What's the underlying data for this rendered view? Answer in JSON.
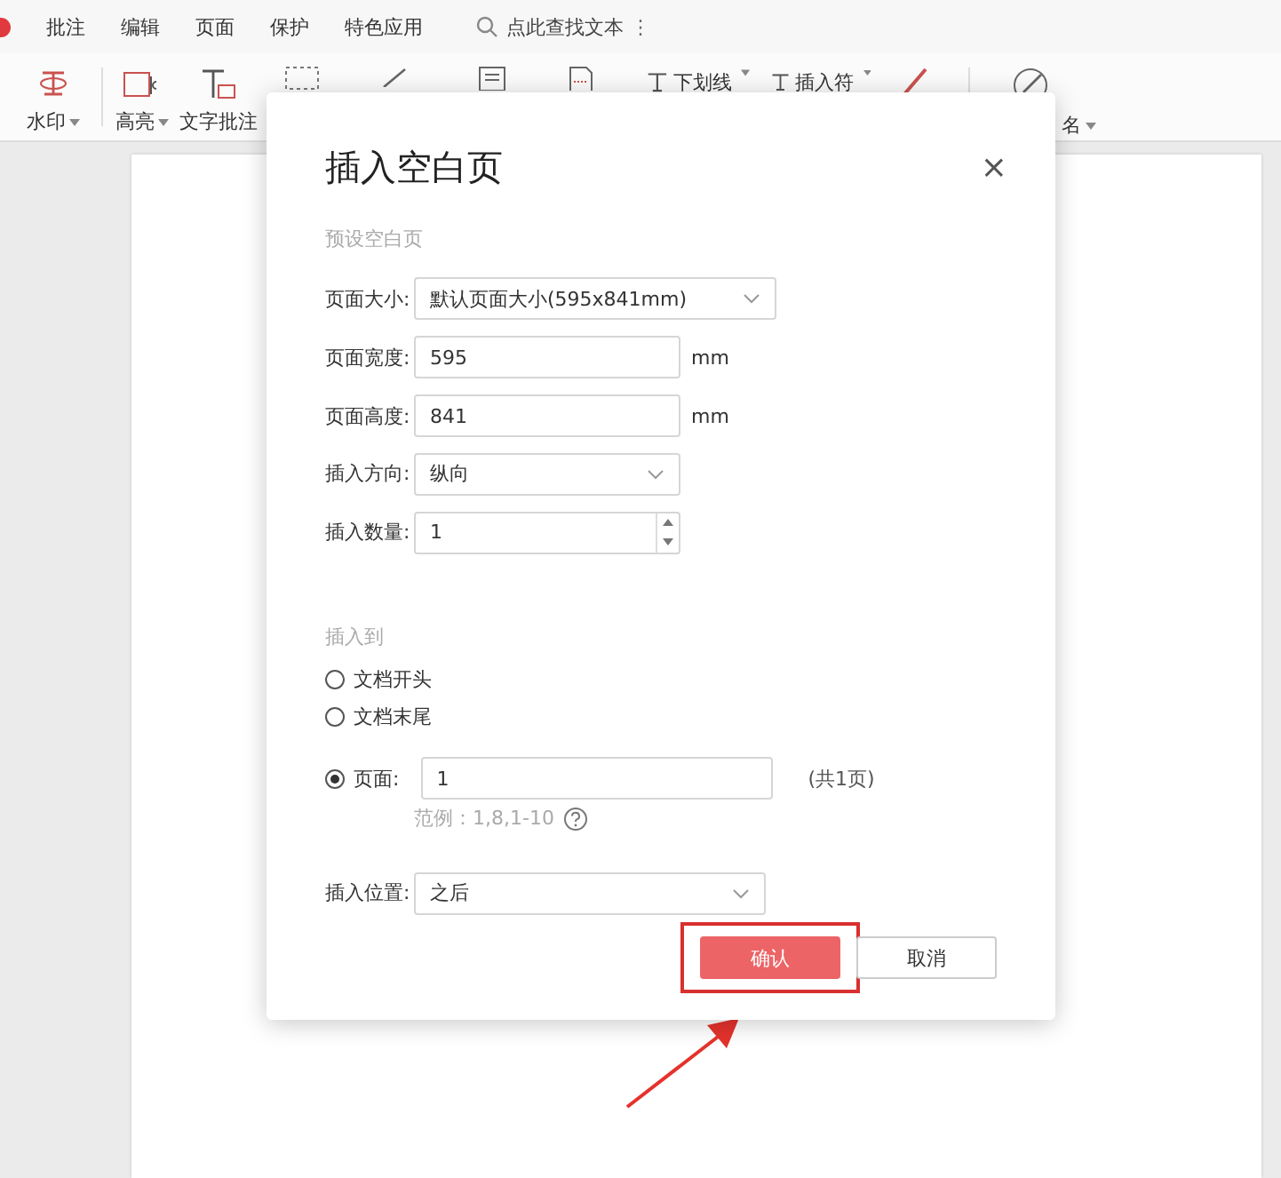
{
  "menu_bar": {
    "items": [
      {
        "label": "批注"
      },
      {
        "label": "编辑"
      },
      {
        "label": "页面"
      },
      {
        "label": "保护"
      },
      {
        "label": "特色应用"
      }
    ],
    "search": {
      "placeholder": "点此查找文本"
    },
    "more": "⋮"
  },
  "toolbar": {
    "items": [
      {
        "kind": "big",
        "label": "水印",
        "caret": true
      },
      {
        "kind": "separator"
      },
      {
        "kind": "big",
        "label": "高亮",
        "caret": true
      },
      {
        "kind": "big",
        "label": "文字批注",
        "caret": false
      },
      {
        "kind": "big"
      },
      {
        "kind": "big"
      },
      {
        "kind": "big"
      },
      {
        "kind": "big"
      },
      {
        "kind": "small",
        "label": "下划线",
        "caret": true
      },
      {
        "kind": "small",
        "label": "插入符",
        "caret": true
      },
      {
        "kind": "big"
      },
      {
        "kind": "separator"
      },
      {
        "kind": "big",
        "label": "名",
        "caret": true
      }
    ]
  },
  "dialog": {
    "title": "插入空白页",
    "close": "×",
    "preset_section": "预设空白页",
    "fields": [
      {
        "kind": "select",
        "label": "页面大小:",
        "value": "默认页面大小(595x841mm)",
        "wide": true
      },
      {
        "kind": "input",
        "label": "页面宽度:",
        "value": "595",
        "unit": "mm"
      },
      {
        "kind": "input",
        "label": "页面高度:",
        "value": "841",
        "unit": "mm"
      },
      {
        "kind": "select",
        "label": "插入方向:",
        "value": "纵向",
        "wide": false
      },
      {
        "kind": "spinner",
        "label": "插入数量:",
        "value": "1"
      }
    ],
    "insert_section": "插入到",
    "radios": [
      {
        "label": "文档开头",
        "selected": false
      },
      {
        "label": "文档末尾",
        "selected": false
      },
      {
        "label": "页面:",
        "selected": true,
        "value": "1",
        "note": "(共1页)",
        "hint": "范例：1,8,1-10"
      }
    ],
    "position": {
      "label": "插入位置:",
      "value": "之后"
    },
    "buttons": [
      {
        "label": "确认",
        "kind": "primary",
        "highlighted": true
      },
      {
        "label": "取消",
        "kind": "secondary",
        "highlighted": false
      }
    ]
  },
  "annotation": {
    "arrow": true
  }
}
